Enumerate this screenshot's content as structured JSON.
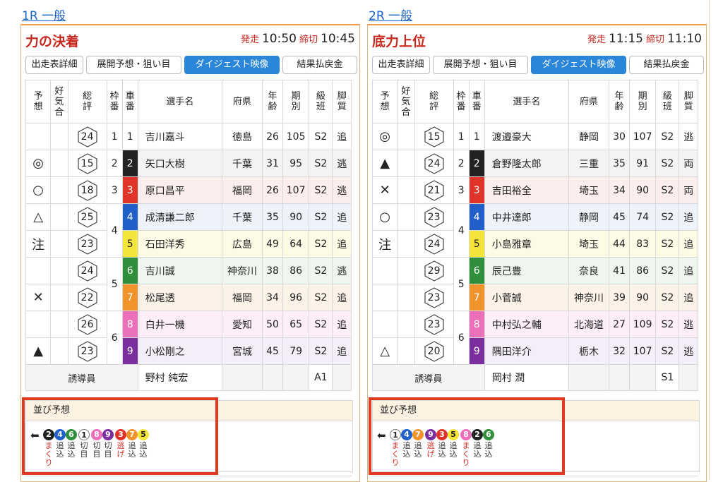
{
  "columns": {
    "yoso": "予想",
    "kouki": "好気合",
    "souhyo": "総評",
    "waku": "枠番",
    "sha": "車番",
    "name": "選手名",
    "pref": "府県",
    "age": "年齢",
    "term": "期別",
    "class": "級班",
    "style": "脚質"
  },
  "tabs": [
    "出走表詳細",
    "展開予想・狙い目",
    "ダイジェスト映像",
    "結果払戻金"
  ],
  "time_labels": {
    "start": "発走",
    "close": "締切"
  },
  "guide_label": "誘導員",
  "lineup_label": "並び予想",
  "arrow": "⬅",
  "car_colors": {
    "1": {
      "bg": "#ffffff",
      "fg": "#222222"
    },
    "2": {
      "bg": "#222222",
      "fg": "#ffffff"
    },
    "3": {
      "bg": "#e0342b",
      "fg": "#ffffff"
    },
    "4": {
      "bg": "#2160c9",
      "fg": "#ffffff"
    },
    "5": {
      "bg": "#f3e53a",
      "fg": "#222222"
    },
    "6": {
      "bg": "#2f8f3a",
      "fg": "#ffffff"
    },
    "7": {
      "bg": "#f0932a",
      "fg": "#ffffff"
    },
    "8": {
      "bg": "#ec6fb9",
      "fg": "#ffffff"
    },
    "9": {
      "bg": "#7b2f9e",
      "fg": "#ffffff"
    }
  },
  "row_tints": {
    "1": "#ffffff",
    "2": "#f3f3f3",
    "3": "#fdeeee",
    "4": "#eef3fb",
    "5": "#fdfbe6",
    "6": "#eef6ee",
    "7": "#fdf2e7",
    "8": "#fdeef7",
    "9": "#f3eef8"
  },
  "races": [
    {
      "link": "1R 一般",
      "title": "力の決着",
      "start_time": "10:50",
      "close_time": "10:45",
      "entries": [
        {
          "mark": "",
          "rating": "24",
          "waku": "1",
          "car": "1",
          "name": "吉川嘉斗",
          "pref": "徳島",
          "age": "26",
          "term": "105",
          "class": "S2",
          "style": "追"
        },
        {
          "mark": "◎",
          "rating": "15",
          "waku": "2",
          "car": "2",
          "name": "矢口大樹",
          "pref": "千葉",
          "age": "31",
          "term": "95",
          "class": "S2",
          "style": "逃"
        },
        {
          "mark": "○",
          "rating": "18",
          "waku": "3",
          "car": "3",
          "name": "原口昌平",
          "pref": "福岡",
          "age": "26",
          "term": "107",
          "class": "S2",
          "style": "逃"
        },
        {
          "mark": "△",
          "rating": "25",
          "waku": "4",
          "car": "4",
          "name": "成清謙二郎",
          "pref": "千葉",
          "age": "35",
          "term": "90",
          "class": "S2",
          "style": "追"
        },
        {
          "mark": "注",
          "rating": "23",
          "waku": "4",
          "car": "5",
          "name": "石田洋秀",
          "pref": "広島",
          "age": "49",
          "term": "64",
          "class": "S2",
          "style": "追"
        },
        {
          "mark": "",
          "rating": "24",
          "waku": "5",
          "car": "6",
          "name": "吉川誠",
          "pref": "神奈川",
          "age": "38",
          "term": "86",
          "class": "S2",
          "style": "逃"
        },
        {
          "mark": "✕",
          "rating": "22",
          "waku": "5",
          "car": "7",
          "name": "松尾透",
          "pref": "福岡",
          "age": "34",
          "term": "96",
          "class": "S2",
          "style": "追"
        },
        {
          "mark": "",
          "rating": "26",
          "waku": "6",
          "car": "8",
          "name": "白井一機",
          "pref": "愛知",
          "age": "50",
          "term": "65",
          "class": "S2",
          "style": "追"
        },
        {
          "mark": "▲",
          "rating": "23",
          "waku": "6",
          "car": "9",
          "name": "小松剛之",
          "pref": "宮城",
          "age": "45",
          "term": "79",
          "class": "S2",
          "style": "追"
        }
      ],
      "guide": {
        "name": "野村 純宏",
        "class": "A1"
      },
      "lineup": [
        {
          "car": "2",
          "style": "まくり",
          "gap": false
        },
        {
          "car": "4",
          "style": "追込",
          "gap": false
        },
        {
          "car": "6",
          "style": "追込",
          "gap": false
        },
        {
          "car": "1",
          "style": "切目",
          "gap": true
        },
        {
          "car": "8",
          "style": "切目",
          "gap": true
        },
        {
          "car": "9",
          "style": "切目",
          "gap": false
        },
        {
          "car": "3",
          "style": "逃げ",
          "gap": true
        },
        {
          "car": "7",
          "style": "追込",
          "gap": false
        },
        {
          "car": "5",
          "style": "追込",
          "gap": false
        }
      ]
    },
    {
      "link": "2R 一般",
      "title": "底力上位",
      "start_time": "11:15",
      "close_time": "11:10",
      "entries": [
        {
          "mark": "◎",
          "rating": "15",
          "waku": "1",
          "car": "1",
          "name": "渡邉豪大",
          "pref": "静岡",
          "age": "30",
          "term": "107",
          "class": "S2",
          "style": "逃"
        },
        {
          "mark": "▲",
          "rating": "24",
          "waku": "2",
          "car": "2",
          "name": "倉野隆太郎",
          "pref": "三重",
          "age": "35",
          "term": "91",
          "class": "S2",
          "style": "両"
        },
        {
          "mark": "✕",
          "rating": "21",
          "waku": "3",
          "car": "3",
          "name": "吉田裕全",
          "pref": "埼玉",
          "age": "34",
          "term": "90",
          "class": "S2",
          "style": "両"
        },
        {
          "mark": "○",
          "rating": "23",
          "waku": "4",
          "car": "4",
          "name": "中井達郎",
          "pref": "静岡",
          "age": "45",
          "term": "74",
          "class": "S2",
          "style": "追"
        },
        {
          "mark": "注",
          "rating": "24",
          "waku": "4",
          "car": "5",
          "name": "小島雅章",
          "pref": "埼玉",
          "age": "44",
          "term": "83",
          "class": "S2",
          "style": "追"
        },
        {
          "mark": "",
          "rating": "29",
          "waku": "5",
          "car": "6",
          "name": "辰己豊",
          "pref": "奈良",
          "age": "41",
          "term": "86",
          "class": "S2",
          "style": "追"
        },
        {
          "mark": "",
          "rating": "23",
          "waku": "5",
          "car": "7",
          "name": "小菅誠",
          "pref": "神奈川",
          "age": "39",
          "term": "90",
          "class": "S2",
          "style": "追"
        },
        {
          "mark": "",
          "rating": "23",
          "waku": "6",
          "car": "8",
          "name": "中村弘之輔",
          "pref": "北海道",
          "age": "27",
          "term": "109",
          "class": "S2",
          "style": "逃"
        },
        {
          "mark": "△",
          "rating": "20",
          "waku": "6",
          "car": "9",
          "name": "隅田洋介",
          "pref": "栃木",
          "age": "32",
          "term": "107",
          "class": "S2",
          "style": "逃"
        }
      ],
      "guide": {
        "name": "岡村 潤",
        "class": "S1"
      },
      "lineup": [
        {
          "car": "1",
          "style": "まくり",
          "gap": false
        },
        {
          "car": "4",
          "style": "追込",
          "gap": false
        },
        {
          "car": "7",
          "style": "追込",
          "gap": false
        },
        {
          "car": "9",
          "style": "逃げ",
          "gap": true
        },
        {
          "car": "3",
          "style": "追込",
          "gap": false
        },
        {
          "car": "5",
          "style": "追込",
          "gap": false
        },
        {
          "car": "8",
          "style": "まくり",
          "gap": true
        },
        {
          "car": "2",
          "style": "追込",
          "gap": false
        },
        {
          "car": "6",
          "style": "追込",
          "gap": false
        }
      ]
    }
  ]
}
